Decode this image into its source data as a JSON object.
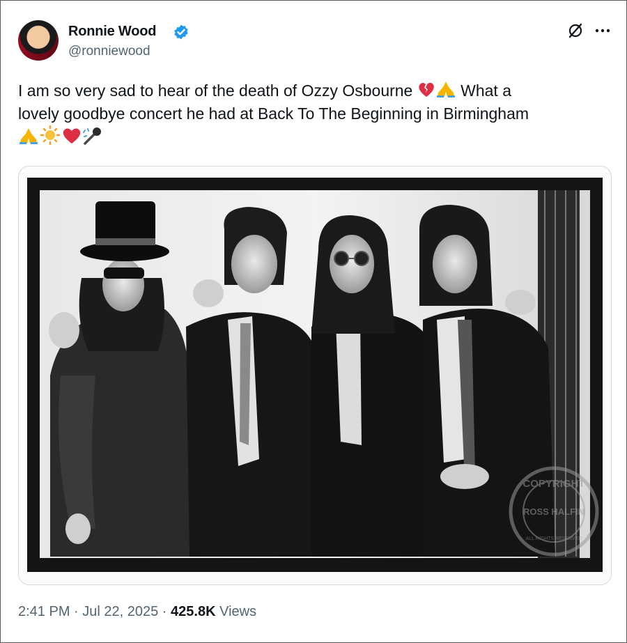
{
  "author": {
    "display_name": "Ronnie Wood",
    "handle": "@ronniewood",
    "verified": true,
    "verified_color": "#1d9bf0"
  },
  "tweet": {
    "text_line1": "I am so very sad to hear of the death of Ozzy Osbourne ",
    "text_line1b": " What a",
    "text_line2": "lovely goodbye concert he had at Back To The Beginning in Birmingham",
    "emoji_line1": [
      "broken-heart-icon",
      "folded-hands-icon"
    ],
    "emoji_line3": [
      "folded-hands-icon",
      "sun-icon",
      "red-heart-icon",
      "microphone-icon"
    ]
  },
  "media": {
    "watermark_top": "COPYRIGHT",
    "watermark_bottom": "ROSS HALFIN",
    "watermark_small": "ALL RIGHTS RESERVED"
  },
  "meta": {
    "time": "2:41 PM",
    "sep1": " · ",
    "date": "Jul 22, 2025",
    "sep2": " · ",
    "views": "425.8K",
    "views_label": " Views"
  },
  "icons": {
    "grok": "grok-icon",
    "more": "more-icon"
  }
}
